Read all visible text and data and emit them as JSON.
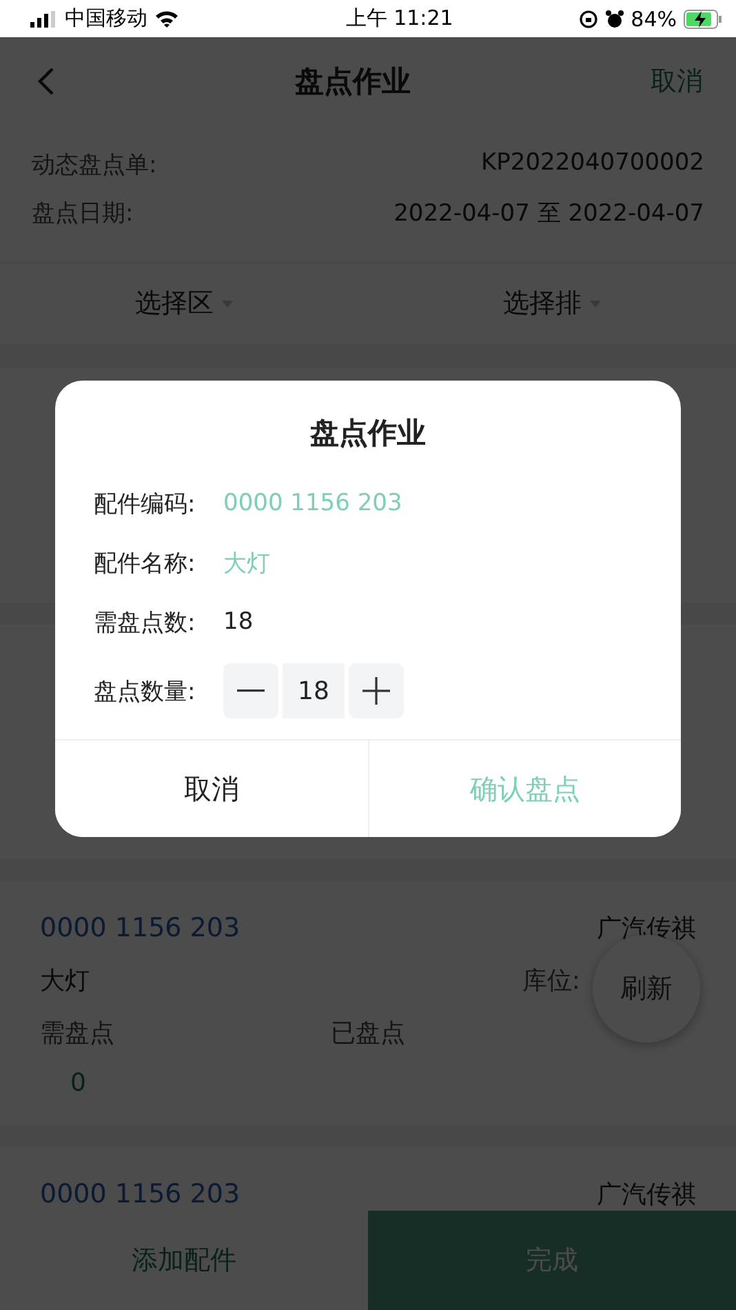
{
  "status_bar": {
    "carrier": "中国移动",
    "time": "上午 11:21",
    "battery": "84%"
  },
  "nav": {
    "title": "盘点作业",
    "action": "取消"
  },
  "info": [
    {
      "label": "动态盘点单:",
      "value": "KP2022040700002"
    },
    {
      "label": "盘点日期:",
      "value": "2022-04-07 至 2022-04-07"
    }
  ],
  "filters": [
    {
      "label": "选择区"
    },
    {
      "label": "选择排"
    }
  ],
  "cards": [
    {
      "kind": "blank"
    },
    {
      "kind": "blank"
    },
    {
      "kind": "full",
      "code": "0000 1156 203",
      "brand": "广汽传祺",
      "name": "大灯",
      "location_label": "库位:",
      "columns": [
        "需盘点",
        "已盘点"
      ],
      "counts": [
        "0"
      ]
    },
    {
      "kind": "partial",
      "code": "0000 1156 203",
      "brand": "广汽传祺"
    }
  ],
  "refresh_button": "刷新",
  "dialog": {
    "title": "盘点作业",
    "rows": [
      {
        "kind": "accent",
        "label": "配件编码:",
        "value": "0000 1156 203"
      },
      {
        "kind": "accent",
        "label": "配件名称:",
        "value": "大灯"
      },
      {
        "kind": "plain",
        "label": "需盘点数:",
        "value": "18"
      },
      {
        "kind": "stepper",
        "label": "盘点数量:",
        "value": "18"
      }
    ],
    "buttons": [
      {
        "kind": "cancel",
        "label": "取消"
      },
      {
        "kind": "confirm",
        "label": "确认盘点"
      }
    ]
  },
  "bottom_bar": [
    {
      "kind": "secondary",
      "label": "添加配件"
    },
    {
      "kind": "primary",
      "label": "完成"
    }
  ]
}
